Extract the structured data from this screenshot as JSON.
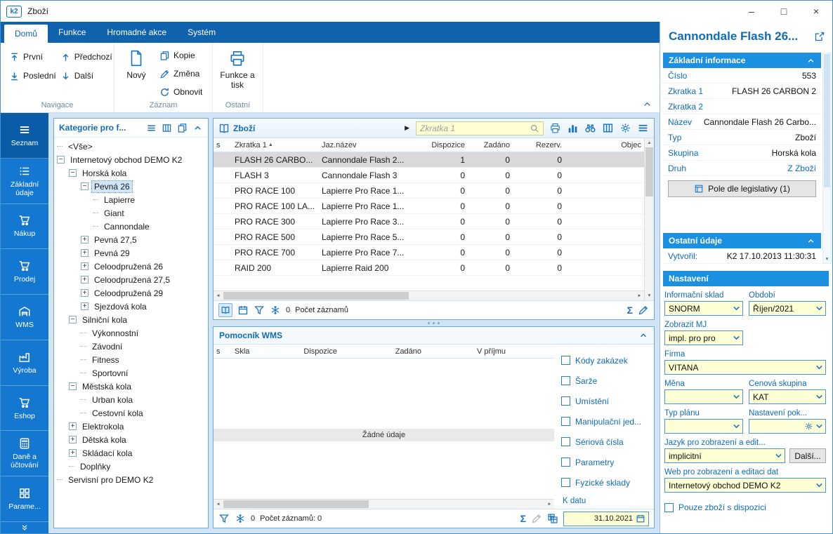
{
  "colors": {
    "accent": "#1473c4",
    "tabbar_blue": "#0f62ab",
    "sidebar_blue": "#1478d1",
    "sidebar_active_blue": "#0b5ca8",
    "section_header_blue": "#1b8fe0",
    "label_blue": "#0f6cb8",
    "input_yellow": "#ffffd6",
    "selected_row_gray": "#d9d9d9",
    "workspace_bg": "#d2e3f3"
  },
  "icons": {
    "sum": "Σ",
    "sort_asc": "▲",
    "play": "▶",
    "arrow_up": "▲",
    "arrow_down": "▼",
    "arrow_left": "◄",
    "arrow_right": "►"
  },
  "titlebar": {
    "app_logo": "k2",
    "title": "Zboží",
    "minimize": "–",
    "maximize": "□",
    "close": "×"
  },
  "ribbon": {
    "tabs": [
      {
        "label": "Domů",
        "active": true
      },
      {
        "label": "Funkce",
        "active": false
      },
      {
        "label": "Hromadné akce",
        "active": false
      },
      {
        "label": "Systém",
        "active": false
      }
    ],
    "nav_group": {
      "label": "Navigace",
      "buttons": [
        {
          "label": "První",
          "icon": "arrow-first-icon"
        },
        {
          "label": "Předchozí",
          "icon": "arrow-up-icon"
        },
        {
          "label": "Poslední",
          "icon": "arrow-last-icon"
        },
        {
          "label": "Další",
          "icon": "arrow-down-icon"
        }
      ]
    },
    "record_group": {
      "label": "Záznam",
      "new_button": "Nový",
      "buttons": [
        {
          "label": "Kopie",
          "icon": "copy-icon"
        },
        {
          "label": "Změna",
          "icon": "pencil-icon"
        },
        {
          "label": "Obnovit",
          "icon": "refresh-icon"
        }
      ]
    },
    "other_group": {
      "label": "Ostatní",
      "print_button": "Funkce a tisk"
    }
  },
  "sidebar": {
    "items": [
      {
        "label": "Seznam",
        "icon": "menu-icon",
        "active": true
      },
      {
        "label": "Základní údaje",
        "icon": "list-icon",
        "active": false
      },
      {
        "label": "Nákup",
        "icon": "cart-icon",
        "active": false
      },
      {
        "label": "Prodej",
        "icon": "cart-icon",
        "active": false
      },
      {
        "label": "WMS",
        "icon": "warehouse-icon",
        "active": false
      },
      {
        "label": "Výroba",
        "icon": "factory-icon",
        "active": false
      },
      {
        "label": "Eshop",
        "icon": "cart-icon",
        "active": false
      },
      {
        "label": "Daně a účtování",
        "icon": "calculator-icon",
        "active": false
      },
      {
        "label": "Parame...",
        "icon": "grid-icon",
        "active": false
      }
    ]
  },
  "tree_panel": {
    "title": "Kategorie pro f...",
    "items": [
      {
        "label": "<Vše>",
        "level": 0,
        "expand": ""
      },
      {
        "label": "Internetový obchod DEMO K2",
        "level": 0,
        "expand": "minus"
      },
      {
        "label": "Horská kola",
        "level": 1,
        "expand": "minus"
      },
      {
        "label": "Pevná 26",
        "level": 2,
        "expand": "minus",
        "selected": true
      },
      {
        "label": "Lapierre",
        "level": 3,
        "expand": ""
      },
      {
        "label": "Giant",
        "level": 3,
        "expand": ""
      },
      {
        "label": "Cannondale",
        "level": 3,
        "expand": ""
      },
      {
        "label": "Pevná 27,5",
        "level": 2,
        "expand": "plus"
      },
      {
        "label": "Pevná 29",
        "level": 2,
        "expand": "plus"
      },
      {
        "label": "Celoodpružená 26",
        "level": 2,
        "expand": "plus"
      },
      {
        "label": "Celoodpružená 27,5",
        "level": 2,
        "expand": "plus"
      },
      {
        "label": "Celoodpružená 29",
        "level": 2,
        "expand": "plus"
      },
      {
        "label": "Sjezdová kola",
        "level": 2,
        "expand": "plus"
      },
      {
        "label": "Silniční kola",
        "level": 1,
        "expand": "minus"
      },
      {
        "label": "Výkonnostní",
        "level": 2,
        "expand": ""
      },
      {
        "label": "Závodní",
        "level": 2,
        "expand": ""
      },
      {
        "label": "Fitness",
        "level": 2,
        "expand": ""
      },
      {
        "label": "Sportovní",
        "level": 2,
        "expand": ""
      },
      {
        "label": "Městská kola",
        "level": 1,
        "expand": "minus"
      },
      {
        "label": "Urban kola",
        "level": 2,
        "expand": ""
      },
      {
        "label": "Cestovní kola",
        "level": 2,
        "expand": ""
      },
      {
        "label": "Elektrokola",
        "level": 1,
        "expand": "plus"
      },
      {
        "label": "Dětská kola",
        "level": 1,
        "expand": "plus"
      },
      {
        "label": "Skládací kola",
        "level": 1,
        "expand": "plus"
      },
      {
        "label": "Doplňky",
        "level": 1,
        "expand": ""
      },
      {
        "label": "Servisní pro DEMO K2",
        "level": 0,
        "expand": ""
      }
    ]
  },
  "goods_panel": {
    "title": "Zboží",
    "search_placeholder": "Zkratka 1",
    "columns": [
      {
        "label": "s",
        "align": "left",
        "sorted": false
      },
      {
        "label": "Zkratka 1",
        "align": "left",
        "sorted": true
      },
      {
        "label": "Jaz.název",
        "align": "left",
        "sorted": false
      },
      {
        "label": "Dispozice",
        "align": "right",
        "sorted": false
      },
      {
        "label": "Zadáno",
        "align": "right",
        "sorted": false
      },
      {
        "label": "Rezerv.",
        "align": "right",
        "sorted": false
      },
      {
        "label": "Objec",
        "align": "right",
        "sorted": false
      }
    ],
    "selected_row": 0,
    "rows": [
      [
        "",
        "FLASH 26 CARBO...",
        "Cannondale Flash 2...",
        "1",
        "0",
        "0",
        ""
      ],
      [
        "",
        "FLASH 3",
        "Cannondale Flash 3",
        "0",
        "0",
        "0",
        ""
      ],
      [
        "",
        "PRO RACE 100",
        "Lapierre Pro Race 1...",
        "0",
        "0",
        "0",
        ""
      ],
      [
        "",
        "PRO RACE 100 LA...",
        "Lapierre Pro Race 1...",
        "0",
        "0",
        "0",
        ""
      ],
      [
        "",
        "PRO RACE 300",
        "Lapierre Pro Race 3...",
        "0",
        "0",
        "0",
        ""
      ],
      [
        "",
        "PRO RACE 500",
        "Lapierre Pro Race 5...",
        "0",
        "0",
        "0",
        ""
      ],
      [
        "",
        "PRO RACE 700",
        "Lapierre Pro Race 7...",
        "0",
        "0",
        "0",
        ""
      ],
      [
        "",
        "RAID 200",
        "Lapierre Raid 200",
        "0",
        "0",
        "0",
        ""
      ]
    ],
    "footer": {
      "filter_count": "0",
      "count_label": "Počet záznamů"
    }
  },
  "wms_panel": {
    "title": "Pomocník WMS",
    "columns": [
      {
        "label": "s",
        "align": "left"
      },
      {
        "label": "Skla",
        "align": "left"
      },
      {
        "label": "Dispozice",
        "align": "right"
      },
      {
        "label": "Zadáno",
        "align": "right"
      },
      {
        "label": "V příjmu",
        "align": "right"
      }
    ],
    "empty_text": "Žádné údaje",
    "footer": {
      "filter_count": "0",
      "count_label": "Počet záznamů: 0"
    },
    "options": [
      "Kódy zakázek",
      "Šarže",
      "Umístění",
      "Manipulační jed...",
      "Sériová čísla",
      "Parametry",
      "Fyzické sklady"
    ],
    "k_datu_label": "K datu",
    "k_datu_value": "31.10.2021"
  },
  "detail_panel": {
    "title": "Cannondale Flash 26...",
    "basic_section": {
      "title": "Základní informace",
      "fields": [
        {
          "label": "Číslo",
          "value": "553",
          "link": false
        },
        {
          "label": "Zkratka 1",
          "value": "FLASH 26 CARBON 2",
          "link": false
        },
        {
          "label": "Zkratka 2",
          "value": "",
          "link": false
        },
        {
          "label": "Název",
          "value": "Cannondale Flash 26 Carbo...",
          "link": false
        },
        {
          "label": "Typ",
          "value": "Zboží",
          "link": false
        },
        {
          "label": "Skupina",
          "value": "Horská kola",
          "link": false
        },
        {
          "label": "Druh",
          "value": "Z Zboží",
          "link": true
        }
      ],
      "legislative_button": "Pole dle legislativy (1)"
    },
    "other_section": {
      "title": "Ostatní údaje",
      "fields": [
        {
          "label": "Vytvořil:",
          "value": "K2 17.10.2013 11:30:31",
          "link": false
        }
      ]
    },
    "settings_section": {
      "title": "Nastavení",
      "info_sklad_label": "Informační sklad",
      "info_sklad_value": "SNORM",
      "obdobi_label": "Období",
      "obdobi_value": "Říjen/2021",
      "zobrazit_mj_label": "Zobrazit MJ",
      "zobrazit_mj_value": "impl. pro pro",
      "firma_label": "Firma",
      "firma_value": "VITANA",
      "mena_label": "Měna",
      "mena_value": "",
      "cenova_label": "Cenová skupina",
      "cenova_value": "KAT",
      "typ_planu_label": "Typ plánu",
      "typ_planu_value": "",
      "nastaveni_pok_label": "Nastavení pok...",
      "nastaveni_pok_value": "",
      "jazyk_label": "Jazyk pro zobrazení a edit...",
      "jazyk_value": "implicitní",
      "dalsi_button": "Další...",
      "web_label": "Web pro zobrazení a editaci dat",
      "web_value": "Internetový obchod DEMO K2",
      "only_available_label": "Pouze zboží s dispozici"
    }
  }
}
